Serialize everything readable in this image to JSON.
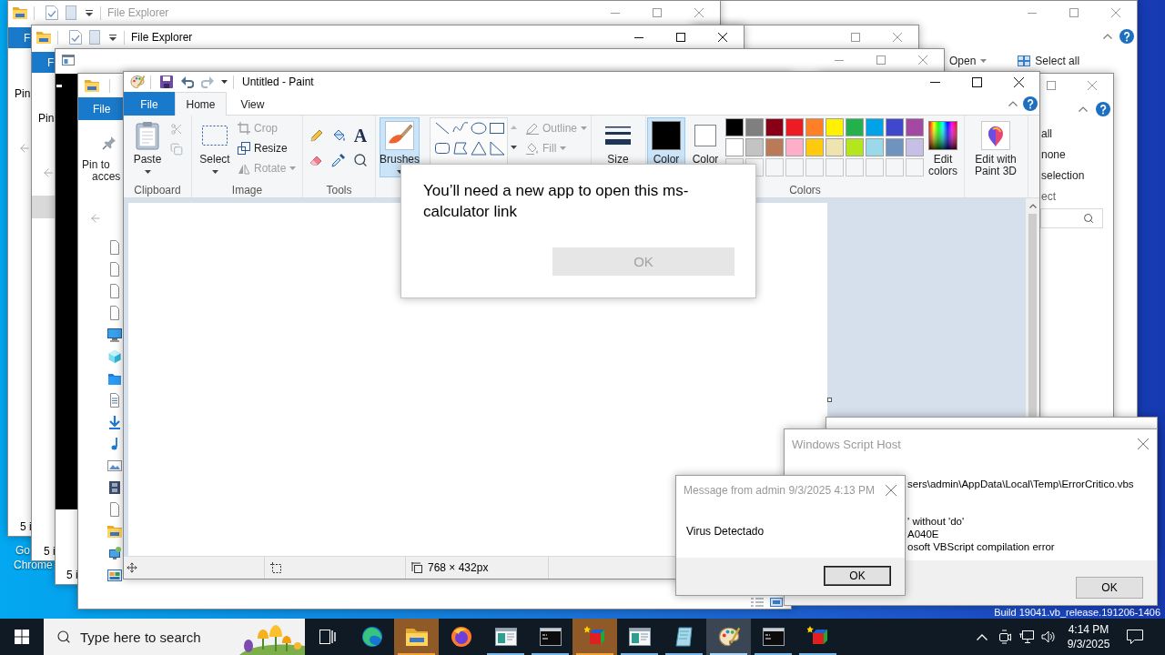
{
  "desktop": {
    "icon_label": [
      "Go",
      "Chrome"
    ],
    "build_text": "Build 19041.vb_release.191206-1406"
  },
  "explorer_right": {
    "active": false,
    "controls": [
      {
        "kind": "minimize"
      },
      {
        "kind": "maximize"
      },
      {
        "kind": "close"
      }
    ],
    "ribbon_items": [
      {
        "kind": "open",
        "label": "Open",
        "dropdown": true
      },
      {
        "kind": "select_all",
        "label": "Select all",
        "dropdown": false
      }
    ]
  },
  "explorer_stack": [
    {
      "title": "File Explorer",
      "active": false,
      "controls": [
        {
          "kind": "minimize"
        },
        {
          "kind": "maximize"
        },
        {
          "kind": "close"
        }
      ],
      "file_tab": "F",
      "ribbon_label": "Pin",
      "status": "5 i"
    },
    {
      "title": "File Explorer",
      "active": true,
      "controls": [
        {
          "kind": "minimize"
        },
        {
          "kind": "maximize"
        },
        {
          "kind": "close"
        }
      ],
      "file_tab": "F",
      "ribbon_label": "Pin",
      "nav_selected": true,
      "status": "5 i"
    }
  ],
  "title_bar_window": {
    "active": false,
    "controls": [
      {
        "kind": "maximize"
      },
      {
        "kind": "close"
      }
    ]
  },
  "console_window": {
    "active": false,
    "controls": [
      {
        "kind": "minimize"
      },
      {
        "kind": "maximize"
      },
      {
        "kind": "close"
      }
    ],
    "status": "5 i"
  },
  "explorer_main": {
    "file_tab": "File",
    "pin_label": [
      "Pin to",
      "acces"
    ],
    "nav_icons": [
      {
        "kind": "file"
      },
      {
        "kind": "file"
      },
      {
        "kind": "file"
      },
      {
        "kind": "file"
      },
      {
        "kind": "monitor"
      },
      {
        "kind": "cube"
      },
      {
        "kind": "blue_folder"
      },
      {
        "kind": "document"
      },
      {
        "kind": "download"
      },
      {
        "kind": "music"
      },
      {
        "kind": "picture"
      },
      {
        "kind": "film"
      },
      {
        "kind": "file"
      },
      {
        "kind": "home_folder"
      },
      {
        "kind": "network"
      },
      {
        "kind": "control_panel"
      }
    ]
  },
  "explorer_side": {
    "active": false,
    "controls": [
      {
        "kind": "maximize"
      },
      {
        "kind": "close"
      }
    ],
    "select_items": [
      "all",
      "none",
      "selection"
    ],
    "select_group_label": "ect"
  },
  "paint": {
    "title": "Untitled - Paint",
    "active": true,
    "controls": [
      {
        "kind": "minimize"
      },
      {
        "kind": "maximize"
      },
      {
        "kind": "close"
      }
    ],
    "tabs": [
      {
        "label": "File",
        "kind": "file",
        "selected": false
      },
      {
        "label": "Home",
        "kind": "tab",
        "selected": true
      },
      {
        "label": "View",
        "kind": "tab",
        "selected": false
      }
    ],
    "clipboard": {
      "paste": "Paste",
      "label": "Clipboard"
    },
    "image": {
      "select": "Select",
      "items": [
        {
          "kind": "crop",
          "label": "Crop",
          "disabled": true,
          "dropdown": false
        },
        {
          "kind": "resize",
          "label": "Resize",
          "disabled": false,
          "dropdown": false
        },
        {
          "kind": "rotate",
          "label": "Rotate",
          "disabled": true,
          "dropdown": true
        }
      ],
      "label": "Image"
    },
    "tools": {
      "text_glyph": "A",
      "label": "Tools"
    },
    "brushes": {
      "label": "Brushes",
      "selected": true
    },
    "shape_options": [
      {
        "kind": "outline",
        "label": "Outline",
        "disabled": true
      },
      {
        "kind": "fill",
        "label": "Fill",
        "disabled": true
      }
    ],
    "size": {
      "label": "Size"
    },
    "colors": {
      "label": "Colors",
      "color_1": {
        "label": "Color",
        "selected": true,
        "color": "#000000"
      },
      "color_2": {
        "label": "Color",
        "selected": false,
        "color": "#ffffff"
      },
      "palette": [
        {
          "color": "#000000"
        },
        {
          "color": "#7f7f7f"
        },
        {
          "color": "#880015"
        },
        {
          "color": "#ed1c24"
        },
        {
          "color": "#ff7f27"
        },
        {
          "color": "#fff200"
        },
        {
          "color": "#22b14c"
        },
        {
          "color": "#00a2e8"
        },
        {
          "color": "#3f48cc"
        },
        {
          "color": "#a349a4"
        },
        {
          "color": "#ffffff"
        },
        {
          "color": "#c3c3c3"
        },
        {
          "color": "#b97a57"
        },
        {
          "color": "#ffaec9"
        },
        {
          "color": "#ffc90e"
        },
        {
          "color": "#efe4b0"
        },
        {
          "color": "#b5e61d"
        },
        {
          "color": "#99d9ea"
        },
        {
          "color": "#7092be"
        },
        {
          "color": "#c8bfe7"
        }
      ],
      "edit_colors": [
        "Edit",
        "colors"
      ]
    },
    "paint_3d": [
      "Edit with",
      "Paint 3D"
    ],
    "canvas_size": "768 × 432px"
  },
  "app_dialog": {
    "message": "You’ll need a new app to open this ms-calculator link",
    "button": {
      "label": "OK",
      "disabled": true
    }
  },
  "script_host": {
    "title": "Windows Script Host",
    "active": false,
    "text_blocks": [
      [
        "sers\\admin\\AppData\\Local\\Temp\\ErrorCritico.vbs"
      ],
      [
        "' without 'do'",
        "A040E",
        "osoft VBScript compilation error"
      ]
    ],
    "button": "OK"
  },
  "message_dialog": {
    "title": "Message from admin 9/3/2025 4:13 PM",
    "active": false,
    "message": "Virus Detectado",
    "button": "OK"
  },
  "taskbar": {
    "search": {
      "placeholder": "Type here to search"
    },
    "apps": [
      {
        "kind": "edge",
        "running": false,
        "flashing": false,
        "selected": false
      },
      {
        "kind": "explorer",
        "running": true,
        "flashing": true,
        "selected": false
      },
      {
        "kind": "firefox",
        "running": false,
        "flashing": false,
        "selected": false
      },
      {
        "kind": "app_window",
        "running": true,
        "flashing": false,
        "selected": false
      },
      {
        "kind": "terminal",
        "running": true,
        "flashing": false,
        "selected": false
      },
      {
        "kind": "cube",
        "running": true,
        "flashing": true,
        "selected": false
      },
      {
        "kind": "app_window",
        "running": true,
        "flashing": false,
        "selected": false
      },
      {
        "kind": "notepad",
        "running": true,
        "flashing": false,
        "selected": false
      },
      {
        "kind": "paint",
        "running": true,
        "flashing": false,
        "selected": true
      },
      {
        "kind": "terminal",
        "running": true,
        "flashing": false,
        "selected": false
      },
      {
        "kind": "cube",
        "running": true,
        "flashing": false,
        "selected": false
      }
    ],
    "clock": {
      "time": "4:14 PM",
      "date": "9/3/2025"
    }
  }
}
